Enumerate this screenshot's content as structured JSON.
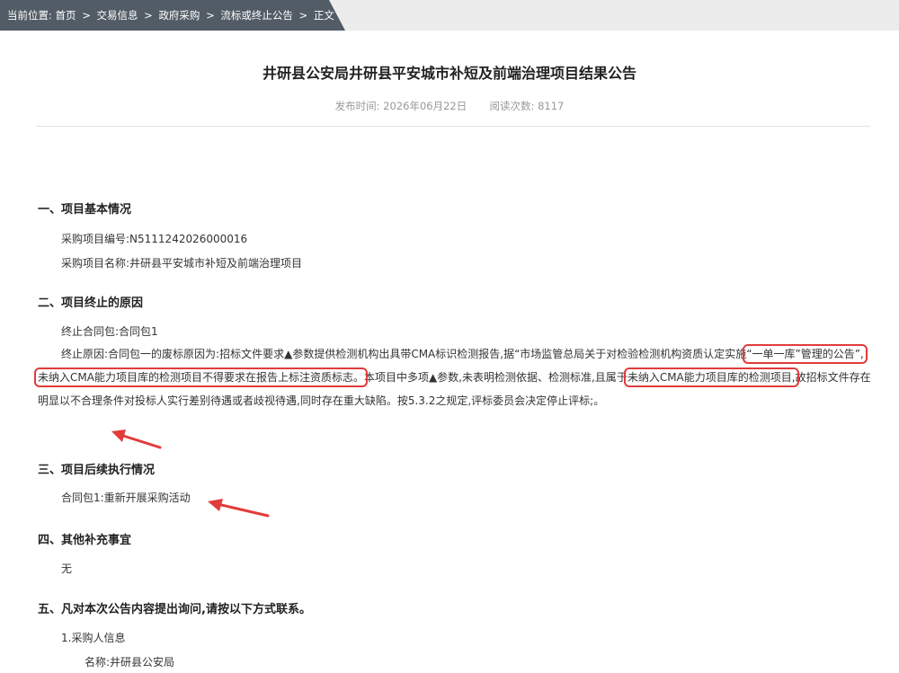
{
  "breadcrumb": {
    "prefix": "当前位置:",
    "items": [
      "首页",
      "交易信息",
      "政府采购",
      "流标或终止公告",
      "正文"
    ],
    "separator": ">"
  },
  "article": {
    "title": "井研县公安局井研县平安城市补短及前端治理项目结果公告",
    "publish_label": "发布时间:",
    "publish_date": "2026年06月22日",
    "views_label": "阅读次数:",
    "views": "8117"
  },
  "sections": {
    "s1": {
      "heading": "一、项目基本情况",
      "project_no": "采购项目编号:N5111242026000016",
      "project_name": "采购项目名称:井研县平安城市补短及前端治理项目"
    },
    "s2": {
      "heading": "二、项目终止的原因",
      "package": "终止合同包:合同包1",
      "reason_a": "终止原因:合同包一的废标原因为:招标文件要求▲参数提供检测机构出具带CMA标识检测报告,据",
      "reason_b": "“市场监管总局关于对检验检测机构资质认定实施",
      "highlight_1": "“一单一库”管理的公告”,未纳入CMA能力项目库的检测项目不得要求在报告上标注资质标志。",
      "reason_c": "本项目中多项▲参数,未表明检测依据、检测标准,且属于",
      "highlight_2": "未纳入CMA能力项目库的检测项目,",
      "reason_d": "故招标文件存在明显以不合理条件对投标人实行差别待遇或者歧视待遇,同时存在重大缺陷。按5.3.2之规定,评标委员会决定停止评标;。"
    },
    "s3": {
      "heading": "三、项目后续执行情况",
      "item": "合同包1:重新开展采购活动"
    },
    "s4": {
      "heading": "四、其他补充事宜",
      "item": "无"
    },
    "s5": {
      "heading": "五、凡对本次公告内容提出询问,请按以下方式联系。",
      "sub1": "1.采购人信息",
      "name": "名称:井研县公安局"
    }
  },
  "colors": {
    "breadcrumb_bg": "#525c66",
    "highlight": "#e23b3b",
    "meta": "#999999"
  }
}
